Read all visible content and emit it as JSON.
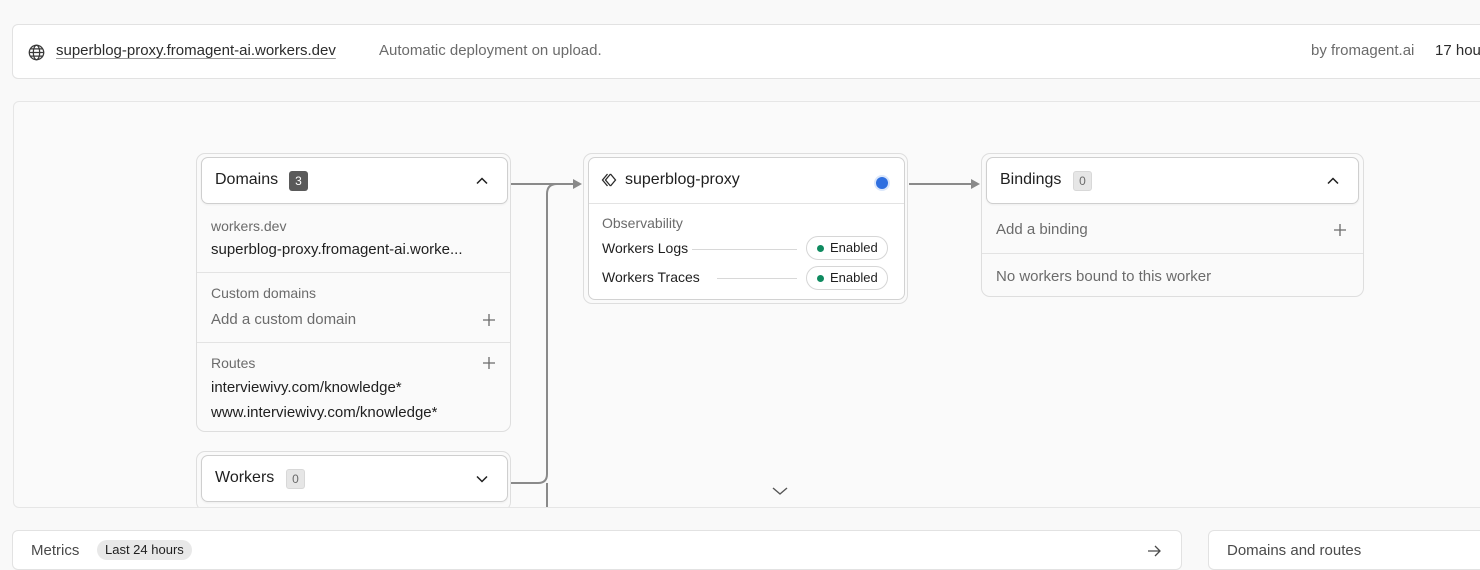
{
  "deployment": {
    "url": "superblog-proxy.fromagent-ai.workers.dev",
    "message": "Automatic deployment on upload.",
    "author": "by fromagent.ai",
    "time": "17 hou"
  },
  "domains": {
    "title": "Domains",
    "count": "3",
    "workers_dev_label": "workers.dev",
    "workers_dev_value": "superblog-proxy.fromagent-ai.worke...",
    "custom_label": "Custom domains",
    "custom_add": "Add a custom domain",
    "routes_label": "Routes",
    "routes": [
      "interviewivy.com/knowledge*",
      "www.interviewivy.com/knowledge*"
    ]
  },
  "workers": {
    "title": "Workers",
    "count": "0"
  },
  "worker": {
    "name": "superblog-proxy",
    "status_color": "#2f6fe0",
    "observability_label": "Observability",
    "logs_label": "Workers Logs",
    "logs_status": "Enabled",
    "traces_label": "Workers Traces",
    "traces_status": "Enabled",
    "enabled_color": "#0e8a5f"
  },
  "bindings": {
    "title": "Bindings",
    "count": "0",
    "add": "Add a binding",
    "empty": "No workers bound to this worker"
  },
  "metrics": {
    "title": "Metrics",
    "range": "Last 24 hours"
  },
  "domains_routes": {
    "title": "Domains and routes"
  },
  "icons": {
    "globe": "globe-icon",
    "chevron_up": "chevron-up-icon",
    "chevron_down": "chevron-down-icon",
    "plus": "plus-icon",
    "worker": "worker-diamond-icon",
    "arrow_right": "arrow-right-icon"
  }
}
